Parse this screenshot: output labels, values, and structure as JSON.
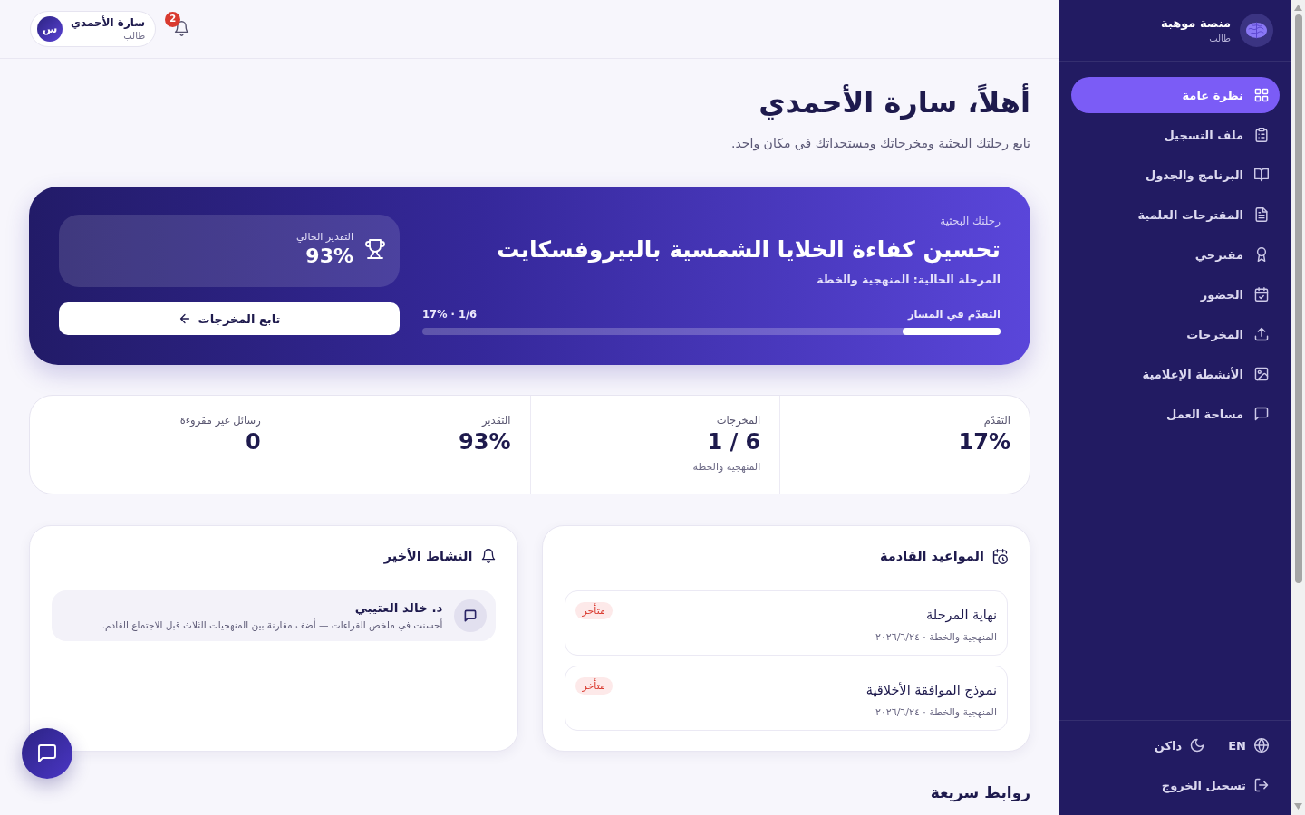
{
  "sidebar": {
    "brand": {
      "title": "منصة موهبة",
      "subtitle": "طالب"
    },
    "items": [
      {
        "label": "نظرة عامة",
        "selected": true
      },
      {
        "label": "ملف التسجيل",
        "selected": false
      },
      {
        "label": "البرنامج والجدول",
        "selected": false
      },
      {
        "label": "المقترحات العلمية",
        "selected": false
      },
      {
        "label": "مقترحي",
        "selected": false
      },
      {
        "label": "الحضور",
        "selected": false
      },
      {
        "label": "المخرجات",
        "selected": false
      },
      {
        "label": "الأنشطة الإعلامية",
        "selected": false
      },
      {
        "label": "مساحة العمل",
        "selected": false
      }
    ],
    "language": "EN",
    "theme": "داكن",
    "logout": "تسجيل الخروج"
  },
  "topbar": {
    "notification_count": "2",
    "user": {
      "initial": "س",
      "name": "سارة الأحمدي",
      "role": "طالب"
    }
  },
  "header": {
    "title": "أهلاً، سارة الأحمدي",
    "subtitle": "تابع رحلتك البحثية ومخرجاتك ومستجداتك في مكان واحد."
  },
  "hero": {
    "eyebrow": "رحلتك البحثية",
    "title": "تحسين كفاءة الخلايا الشمسية بالبيروفسكايت",
    "phase": "المرحلة الحالية: المنهجية والخطة",
    "progress": {
      "label": "التقدّم في المسار",
      "reading": "17% · 1/6",
      "level": 0.17
    },
    "grade": {
      "label": "التقدير الحالي",
      "value": "93%"
    },
    "button": "تابع المخرجات"
  },
  "stats": [
    {
      "label": "التقدّم",
      "value": "17%"
    },
    {
      "label": "المخرجات",
      "value": "1 / 6",
      "note": "المنهجية والخطة"
    },
    {
      "label": "التقدير",
      "value": "93%"
    },
    {
      "label": "رسائل غير مقروءة",
      "value": "0"
    }
  ],
  "upcoming": {
    "title": "المواعيد القادمة",
    "items": [
      {
        "title": "نهاية المرحلة",
        "meta": "المنهجية والخطة · ٢٠٢٦/٦/٢٤",
        "status": "متأخر"
      },
      {
        "title": "نموذج الموافقة الأخلاقية",
        "meta": "المنهجية والخطة · ٢٠٢٦/٦/٢٤",
        "status": "متأخر"
      }
    ]
  },
  "activity": {
    "title": "النشاط الأخير",
    "items": [
      {
        "author": "د. خالد العتيبي",
        "text": "أحسنت في ملخص القراءات — أضف مقارنة بين المنهجيات الثلاث قبل الاجتماع القادم."
      }
    ]
  },
  "quick_links": {
    "title": "روابط سريعة"
  }
}
